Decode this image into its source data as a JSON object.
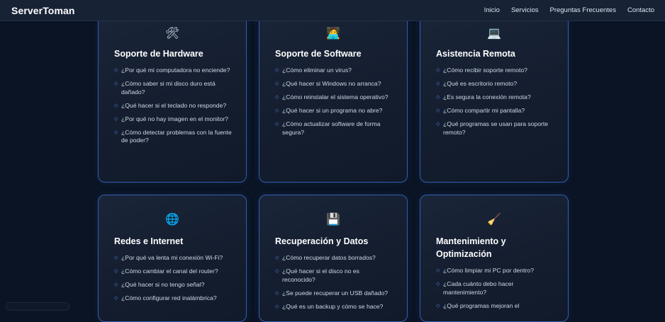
{
  "nav": {
    "brand": "ServerToman",
    "links": [
      "Inicio",
      "Servicios",
      "Preguntas Frecuentes",
      "Contacto"
    ]
  },
  "cards": [
    {
      "icon": "🛠",
      "icon_name": "tools-icon",
      "title": "Soporte de Hardware",
      "items": [
        "¿Por qué mi computadora no enciende?",
        "¿Cómo saber si mi disco duro está dañado?",
        "¿Qué hacer si el teclado no responde?",
        "¿Por qué no hay imagen en el monitor?",
        "¿Cómo detectar problemas con la fuente de poder?"
      ]
    },
    {
      "icon": "🧑‍💻",
      "icon_name": "technician-icon",
      "title": "Soporte de Software",
      "items": [
        "¿Cómo eliminar un virus?",
        "¿Qué hacer si Windows no arranca?",
        "¿Cómo reinstalar el sistema operativo?",
        "¿Qué hacer si un programa no abre?",
        "¿Cómo actualizar software de forma segura?"
      ]
    },
    {
      "icon": "💻",
      "icon_name": "laptop-icon",
      "title": "Asistencia Remota",
      "items": [
        "¿Cómo recibir soporte remoto?",
        "¿Qué es escritorio remoto?",
        "¿Es segura la conexión remota?",
        "¿Cómo compartir mi pantalla?",
        "¿Qué programas se usan para soporte remoto?"
      ]
    },
    {
      "icon": "🌐",
      "icon_name": "globe-icon",
      "title": "Redes e Internet",
      "items": [
        "¿Por qué va lenta mi conexión Wi-Fi?",
        "¿Cómo cambiar el canal del router?",
        "¿Qué hacer si no tengo señal?",
        "¿Cómo configurar red inalámbrica?"
      ]
    },
    {
      "icon": "💾",
      "icon_name": "floppy-disk-icon",
      "title": "Recuperación y Datos",
      "items": [
        "¿Cómo recuperar datos borrados?",
        "¿Qué hacer si el disco no es reconocido?",
        "¿Se puede recuperar un USB dañado?",
        "¿Qué es un backup y cómo se hace?"
      ]
    },
    {
      "icon": "🧹",
      "icon_name": "broom-icon",
      "title": "Mantenimiento y Optimización",
      "items": [
        "¿Cómo limpiar mi PC por dentro?",
        "¿Cada cuánto debo hacer mantenimiento?",
        "¿Qué programas mejoran el"
      ]
    }
  ]
}
